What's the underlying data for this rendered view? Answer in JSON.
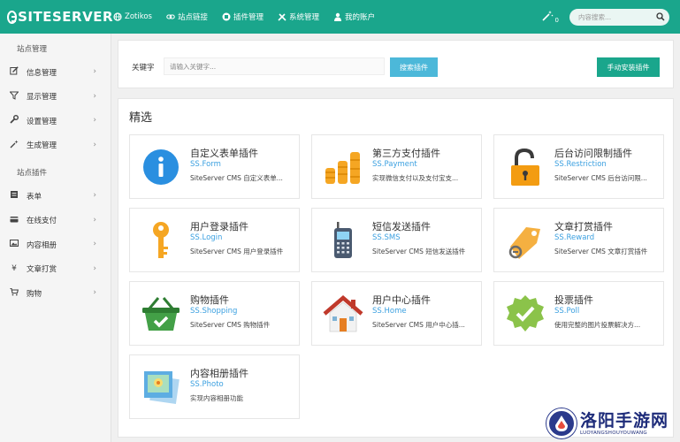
{
  "header": {
    "logo": "SITESERVER",
    "nav": [
      {
        "icon": "globe-icon",
        "label": "Zotikos"
      },
      {
        "icon": "link-icon",
        "label": "站点链接"
      },
      {
        "icon": "puzzle-icon",
        "label": "插件管理"
      },
      {
        "icon": "tools-icon",
        "label": "系统管理"
      },
      {
        "icon": "user-icon",
        "label": "我的账户"
      }
    ],
    "notification_count": "0",
    "search_placeholder": "内容搜索..."
  },
  "sidebar": {
    "section1": "站点管理",
    "items1": [
      {
        "icon": "edit-icon",
        "label": "信息管理"
      },
      {
        "icon": "filter-icon",
        "label": "显示管理"
      },
      {
        "icon": "wrench-icon",
        "label": "设置管理"
      },
      {
        "icon": "magic-icon",
        "label": "生成管理"
      }
    ],
    "section2": "站点插件",
    "items2": [
      {
        "icon": "form-icon",
        "label": "表单"
      },
      {
        "icon": "card-icon",
        "label": "在线支付"
      },
      {
        "icon": "image-icon",
        "label": "内容相册"
      },
      {
        "icon": "yen-icon",
        "label": "文章打赏"
      },
      {
        "icon": "cart-icon",
        "label": "购物"
      }
    ]
  },
  "search": {
    "label": "关键字",
    "placeholder": "请输入关键字...",
    "search_button": "搜索插件",
    "install_button": "手动安装插件"
  },
  "featured": {
    "title": "精选",
    "plugins": [
      {
        "icon": "info-icon",
        "title": "自定义表单插件",
        "code": "SS.Form",
        "desc": "SiteServer CMS 自定义表单..."
      },
      {
        "icon": "coins-icon",
        "title": "第三方支付插件",
        "code": "SS.Payment",
        "desc": "实现微信支付以及支付宝支..."
      },
      {
        "icon": "lock-icon",
        "title": "后台访问限制插件",
        "code": "SS.Restriction",
        "desc": "SiteServer CMS 后台访问限..."
      },
      {
        "icon": "key-icon",
        "title": "用户登录插件",
        "code": "SS.Login",
        "desc": "SiteServer CMS 用户登录插件"
      },
      {
        "icon": "phone-icon",
        "title": "短信发送插件",
        "code": "SS.SMS",
        "desc": "SiteServer CMS 短信发送插件"
      },
      {
        "icon": "tag-icon",
        "title": "文章打赏插件",
        "code": "SS.Reward",
        "desc": "SiteServer CMS 文章打赏插件"
      },
      {
        "icon": "basket-icon",
        "title": "购物插件",
        "code": "SS.Shopping",
        "desc": "SiteServer CMS 购物插件"
      },
      {
        "icon": "home-icon",
        "title": "用户中心插件",
        "code": "SS.Home",
        "desc": "SiteServer CMS 用户中心插..."
      },
      {
        "icon": "badge-check-icon",
        "title": "投票插件",
        "code": "SS.Poll",
        "desc": "使用完整的图片投票解决方..."
      },
      {
        "icon": "photo-icon",
        "title": "内容相册插件",
        "code": "SS.Photo",
        "desc": "实现内容相册功能"
      }
    ]
  },
  "watermark": {
    "main": "洛阳手游网",
    "sub": "LUOYANGSHOUYOUWANG"
  },
  "colors": {
    "primary": "#1aa68c",
    "link": "#3ba0e0",
    "search_button": "#4cb8d9"
  }
}
